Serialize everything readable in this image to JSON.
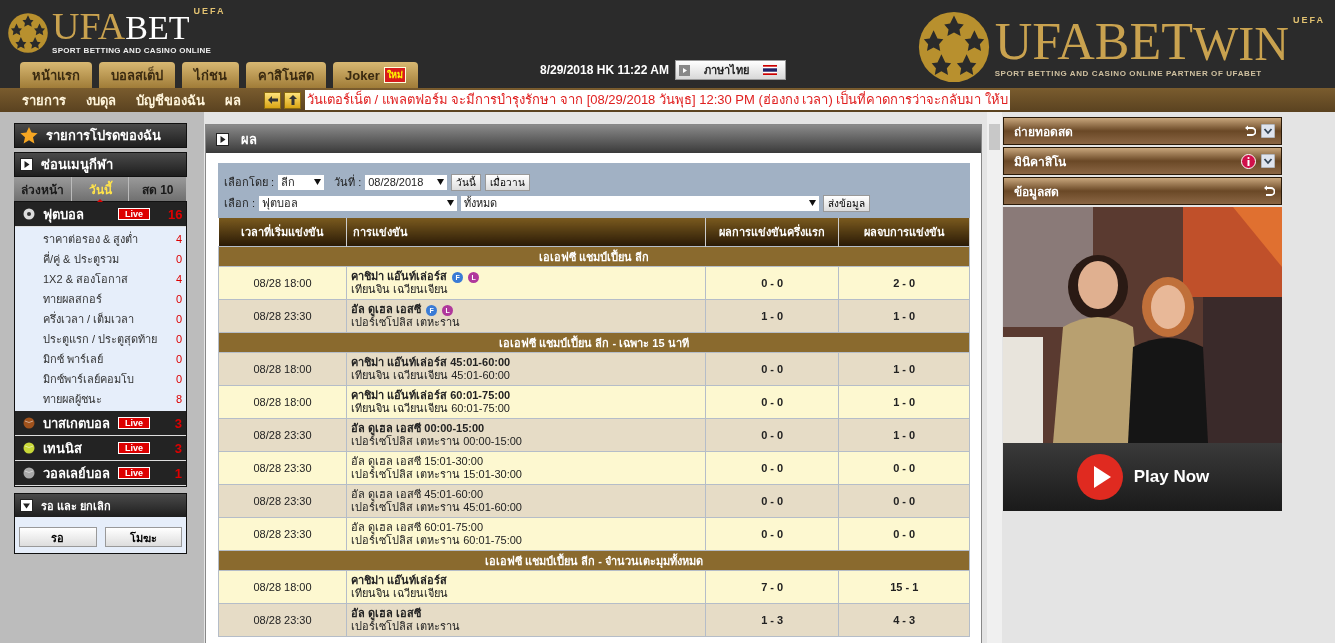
{
  "header": {
    "logo": {
      "brand_left": "UFA",
      "brand_right": "BET",
      "badge": "UEFA",
      "tagline": "SPORT BETTING AND CASINO ONLINE"
    },
    "tabs": [
      {
        "label": "หน้าแรก"
      },
      {
        "label": "บอลสเต็ป"
      },
      {
        "label": "ไก่ชน"
      },
      {
        "label": "คาสิโนสด"
      },
      {
        "label": "Joker",
        "badge": "ใหม่"
      }
    ],
    "datetime": "8/29/2018 HK 11:22 AM",
    "language": "ภาษาไทย",
    "partner_logo": {
      "brand_left": "UFABET",
      "brand_right": "WIN",
      "badge": "UEFA",
      "tagline": "SPORT BETTING AND CASINO ONLINE PARTNER OF UFABET"
    }
  },
  "nav": {
    "items": [
      "รายการ",
      "งบดุล",
      "บัญชีของฉัน",
      "ผล"
    ],
    "ticker": "วันเตอร์เน็ต / แพลตฟอร์ม จะมีการบำรุงรักษา จาก [08/29/2018 วันพุธ] 12:30 PM (ฮ่องกง เวลา) เป็นที่คาดการว่าจะกลับมา ให้บ"
  },
  "sidebar": {
    "favorites": "รายการโปรดของฉัน",
    "sports_menu": "ซ่อนเมนูกีฬา",
    "tabs": [
      {
        "label": "ล่วงหน้า",
        "selected": false
      },
      {
        "label": "วันนี้",
        "selected": true
      },
      {
        "label": "สด 10",
        "selected": false
      }
    ],
    "sports": [
      {
        "kind": "football",
        "name": "ฟุตบอล",
        "live": "Live",
        "count": "16",
        "children": [
          {
            "name": "ราคาต่อรอง & สูงต่ำ",
            "count": "4"
          },
          {
            "name": "คี่/คู่ & ประตูรวม",
            "count": "0"
          },
          {
            "name": "1X2 & สองโอกาส",
            "count": "4"
          },
          {
            "name": "ทายผลสกอร์",
            "count": "0"
          },
          {
            "name": "ครึ่งเวลา / เต็มเวลา",
            "count": "0"
          },
          {
            "name": "ประตูแรก / ประตูสุดท้าย",
            "count": "0"
          },
          {
            "name": "มิกซ์ พาร์เลย์",
            "count": "0"
          },
          {
            "name": "มิกซ์พาร์เลย์คอมโบ",
            "count": "0"
          },
          {
            "name": "ทายผลผู้ชนะ",
            "count": "8"
          }
        ]
      },
      {
        "kind": "basketball",
        "name": "บาสเกตบอล",
        "live": "Live",
        "count": "3"
      },
      {
        "kind": "tennis",
        "name": "เทนนิส",
        "live": "Live",
        "count": "3"
      },
      {
        "kind": "volleyball",
        "name": "วอลเลย์บอล",
        "live": "Live",
        "count": "1"
      }
    ],
    "waiting": {
      "title": "รอ และ ยกเลิก",
      "buttons": [
        "รอ",
        "โมฆะ"
      ]
    }
  },
  "results": {
    "title": "ผล",
    "filters": {
      "by_label": "เลือกโดย :",
      "by_value": "ลีก",
      "date_label": "วันที่ :",
      "date_value": "08/28/2018",
      "today_button": "วันนี้",
      "yesterday_button": "เมื่อวาน",
      "select_label": "เลือก :",
      "sport_value": "ฟุตบอล",
      "league_value": "ทั้งหมด",
      "submit_button": "ส่งข้อมูล"
    },
    "columns": [
      "เวลาที่เริ่มแข่งขัน",
      "การแข่งขัน",
      "ผลการแข่งขันครึ่งแรก",
      "ผลจบการแข่งขัน"
    ],
    "sections": [
      {
        "title": "เอเอฟซี แชมป์เปี้ยน ลีก",
        "matches": [
          {
            "time": "08/28 18:00",
            "home": "คาชิม่า แอ๊นท์เล่อร์ส",
            "away": "เทียนจิน เฉวียนเจียน",
            "bold": true,
            "shaded": false,
            "icons": [
              {
                "label": "F",
                "color": "#3a7bd5"
              },
              {
                "label": "L",
                "color": "#b0389c"
              }
            ],
            "half_time": "0 - 0",
            "full_time": "2 - 0"
          },
          {
            "time": "08/28 23:30",
            "home": "อัล ดูเฮล เอสซี",
            "away": "เปอร์เซโปลิส เตหะราน",
            "bold": true,
            "shaded": true,
            "icons": [
              {
                "label": "F",
                "color": "#3a7bd5"
              },
              {
                "label": "L",
                "color": "#b0389c"
              }
            ],
            "half_time": "1 - 0",
            "full_time": "1 - 0"
          }
        ]
      },
      {
        "title": "เอเอฟซี แชมป์เปี้ยน ลีก - เฉพาะ 15 นาที",
        "matches": [
          {
            "time": "08/28 18:00",
            "home": "คาชิม่า แอ๊นท์เล่อร์ส 45:01-60:00",
            "away": "เทียนจิน เฉวียนเจียน 45:01-60:00",
            "bold": true,
            "shaded": true,
            "half_time": "0 - 0",
            "full_time": "1 - 0"
          },
          {
            "time": "08/28 18:00",
            "home": "คาชิม่า แอ๊นท์เล่อร์ส 60:01-75:00",
            "away": "เทียนจิน เฉวียนเจียน 60:01-75:00",
            "bold": true,
            "shaded": false,
            "half_time": "0 - 0",
            "full_time": "1 - 0"
          },
          {
            "time": "08/28 23:30",
            "home": "อัล ดูเฮล เอสซี 00:00-15:00",
            "away": "เปอร์เซโปลิส เตหะราน 00:00-15:00",
            "bold": true,
            "shaded": true,
            "half_time": "0 - 0",
            "full_time": "1 - 0"
          },
          {
            "time": "08/28 23:30",
            "home": "อัล ดูเฮล เอสซี 15:01-30:00",
            "away": "เปอร์เซโปลิส เตหะราน 15:01-30:00",
            "bold": false,
            "shaded": false,
            "half_time": "0 - 0",
            "full_time": "0 - 0"
          },
          {
            "time": "08/28 23:30",
            "home": "อัล ดูเฮล เอสซี 45:01-60:00",
            "away": "เปอร์เซโปลิส เตหะราน 45:01-60:00",
            "bold": false,
            "shaded": true,
            "half_time": "0 - 0",
            "full_time": "0 - 0"
          },
          {
            "time": "08/28 23:30",
            "home": "อัล ดูเฮล เอสซี 60:01-75:00",
            "away": "เปอร์เซโปลิส เตหะราน 60:01-75:00",
            "bold": false,
            "shaded": false,
            "half_time": "0 - 0",
            "full_time": "0 - 0"
          }
        ]
      },
      {
        "title": "เอเอฟซี แชมป์เปี้ยน ลีก - จำนวนเตะมุมทั้งหมด",
        "matches": [
          {
            "time": "08/28 18:00",
            "home": "คาชิม่า แอ๊นท์เล่อร์ส",
            "away": "เทียนจิน เฉวียนเจียน",
            "bold": true,
            "shaded": false,
            "half_time": "7 - 0",
            "full_time": "15 - 1"
          },
          {
            "time": "08/28 23:30",
            "home": "อัล ดูเฮล เอสซี",
            "away": "เปอร์เซโปลิส เตหะราน",
            "bold": true,
            "shaded": true,
            "half_time": "1 - 3",
            "full_time": "4 - 3"
          }
        ]
      }
    ]
  },
  "right_panel": {
    "sections": [
      {
        "title": "ถ่ายทอดสด",
        "kind": "stream"
      },
      {
        "title": "มินิคาสิโน",
        "kind": "casino"
      },
      {
        "title": "ข้อมูลสด",
        "kind": "livedata"
      }
    ],
    "promo": {
      "kind": "picture",
      "button": "Play Now"
    }
  }
}
